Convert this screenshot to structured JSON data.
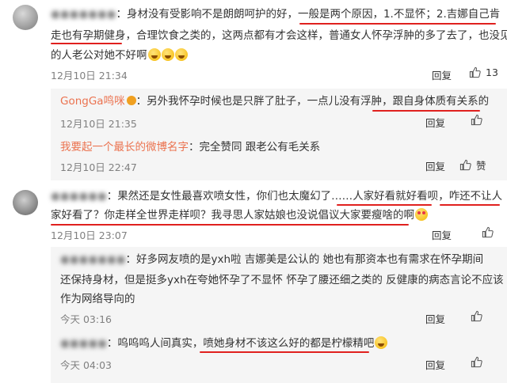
{
  "comments": [
    {
      "username": "",
      "lines": [
        [
          "身材没有受影响不是朗朗呵护的好，",
          "一般是两个原因",
          "，",
          "1.不显怀",
          "；",
          "2.吉娜自己肯"
        ],
        [
          "走也有孕期健身",
          "，合理饮食之类的，这两点都有才会这样，普通女人怀孕浮肿的多了去了，也没见"
        ],
        [
          "的人老公对她不好啊"
        ]
      ],
      "time": "12月10日 21:34",
      "reply_label": "回复",
      "likes": "13"
    },
    {
      "username": "GongGa鸣咪",
      "text_before": "另外我怀孕时候也是只胖了肚子，一点儿没有浮肿，",
      "text_mark": "跟自身体质有关系的",
      "time": "12月10日 21:35",
      "reply_label": "回复",
      "likes": ""
    },
    {
      "username": "我要起一个最长的微博名字",
      "text": "完全赞同 跟老公有毛关系",
      "time": "12月10日 22:47",
      "reply_label": "回复",
      "likes_label": "赞"
    },
    {
      "username": "",
      "lines": [
        [
          "果然还是女性最喜欢喷女性，你们也太魔幻了……",
          "人家好看就好看呗",
          "，",
          "咋还不让人"
        ],
        [
          "家好看了？你走样全世界走样呗？",
          "我寻思人家姑娘也没说倡议大家要瘦啥的啊"
        ]
      ],
      "time": "12月10日 23:07",
      "reply_label": "回复",
      "likes": ""
    },
    {
      "username": "",
      "lines": [
        "好多网友喷的是yxh啦 吉娜美是公认的 她也有那资本也有需求在怀孕期间",
        "还保持身材，但是挺多yxh在夸她怀孕了不显怀 怀孕了腰还细之类的 反健康的病态言论不应该",
        "作为网络导向的"
      ],
      "time": "今天 03:16",
      "reply_label": "回复",
      "likes": ""
    },
    {
      "username": "",
      "text_before": "呜呜呜人间真实，",
      "text_mark": "喷她身材不该这么好的都是柠檬精吧",
      "time": "今天 04:03",
      "reply_label": "回复",
      "likes": ""
    }
  ],
  "colors": {
    "username": "#eb7350",
    "underline": "#e0201e",
    "sub_bg": "#f5f5f5",
    "time": "#808080"
  },
  "icons": [
    "thumb-up-icon",
    "grin-emoji-icon",
    "heart-eyes-emoji-icon",
    "vip-badge-icon"
  ]
}
